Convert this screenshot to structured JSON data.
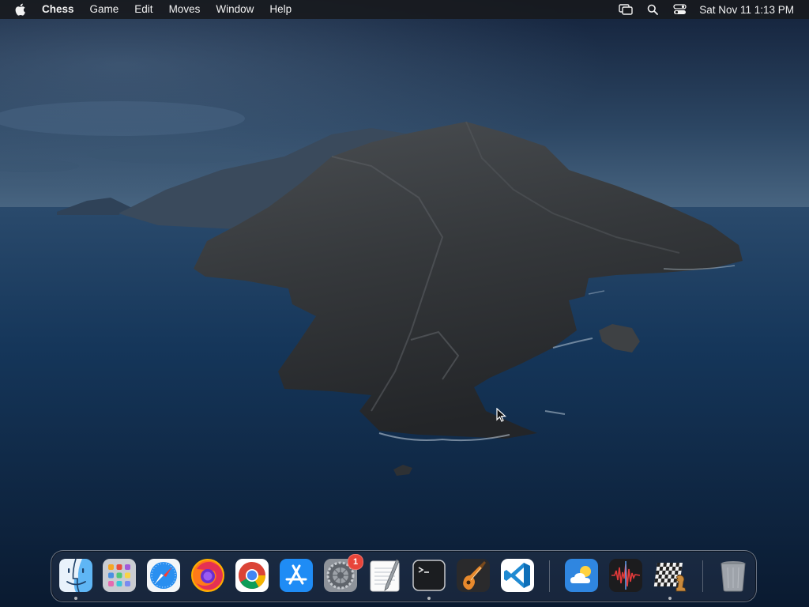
{
  "menubar": {
    "apple_icon": "apple-icon",
    "app_name": "Chess",
    "menus": [
      "Game",
      "Edit",
      "Moves",
      "Window",
      "Help"
    ],
    "status_icons": [
      "screen-mirroring-icon",
      "spotlight-search-icon",
      "control-center-icon"
    ],
    "clock": "Sat Nov 11  1:13 PM"
  },
  "desktop": {
    "wallpaper": "catalina-island-night",
    "colors": {
      "sky_top": "#15233b",
      "sky_bottom": "#3d5a7a",
      "sea": "#0f2540",
      "rock": "#3a3d40"
    }
  },
  "dock": {
    "apps": [
      {
        "name": "Finder",
        "icon": "finder-icon",
        "running": true
      },
      {
        "name": "Launchpad",
        "icon": "launchpad-icon",
        "running": false
      },
      {
        "name": "Safari",
        "icon": "safari-icon",
        "running": false
      },
      {
        "name": "Firefox",
        "icon": "firefox-icon",
        "running": false
      },
      {
        "name": "Google Chrome",
        "icon": "chrome-icon",
        "running": false
      },
      {
        "name": "App Store",
        "icon": "app-store-icon",
        "running": false
      },
      {
        "name": "System Preferences",
        "icon": "system-preferences-icon",
        "running": false,
        "badge": "1"
      },
      {
        "name": "TextEdit",
        "icon": "textedit-icon",
        "running": false
      },
      {
        "name": "Terminal",
        "icon": "terminal-icon",
        "running": true
      },
      {
        "name": "GarageBand",
        "icon": "garageband-icon",
        "running": false
      },
      {
        "name": "Visual Studio Code",
        "icon": "vscode-icon",
        "running": false
      },
      {
        "name": "Weather",
        "icon": "weather-icon",
        "running": false
      },
      {
        "name": "Audio Editor",
        "icon": "audio-waveform-icon",
        "running": false
      },
      {
        "name": "Chess",
        "icon": "chess-icon",
        "running": true
      },
      {
        "name": "Trash",
        "icon": "trash-icon",
        "running": false
      }
    ]
  }
}
